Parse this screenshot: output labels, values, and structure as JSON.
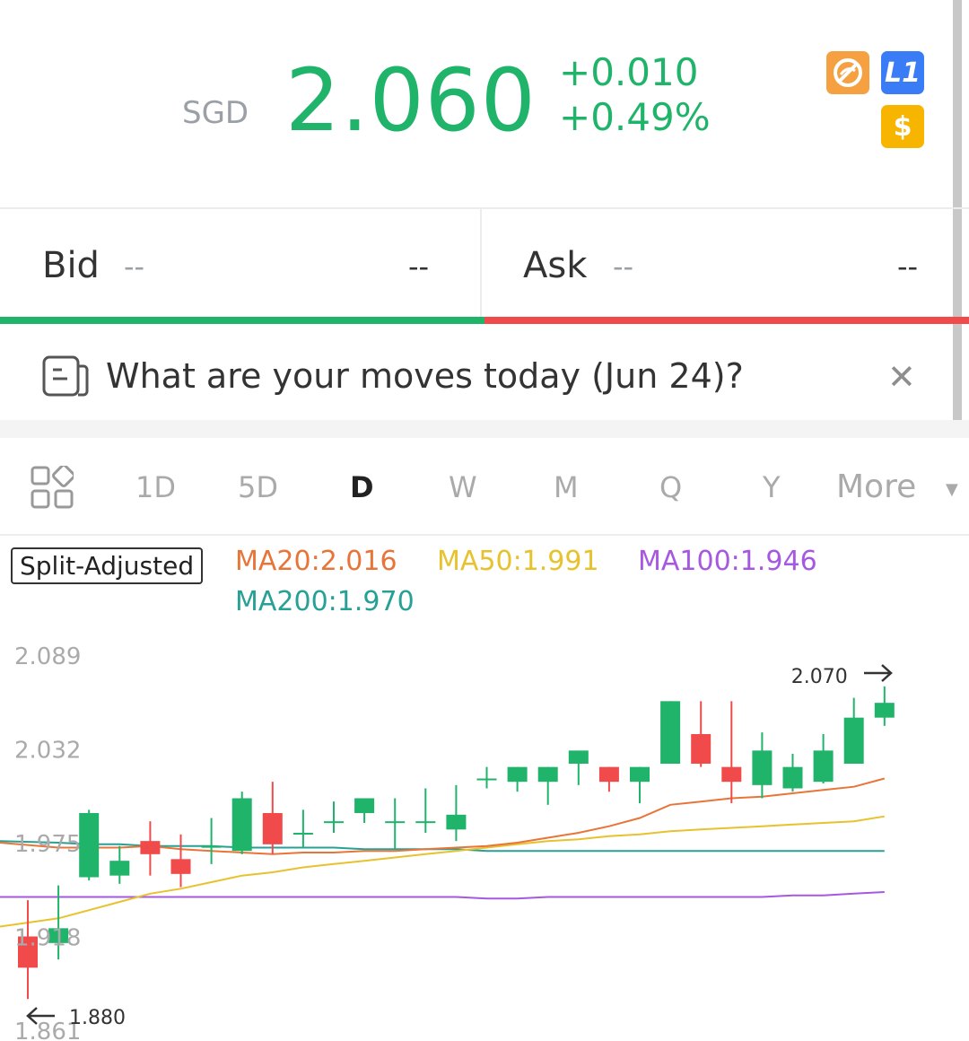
{
  "quote": {
    "currency": "SGD",
    "price": "2.060",
    "change": "+0.010",
    "change_pct": "+0.49%",
    "color": "#1fb46a"
  },
  "badges": [
    {
      "icon": "no-short-icon",
      "color": "#f5a142"
    },
    {
      "label": "L1",
      "icon": "level1-icon",
      "color": "#3a7bf6"
    },
    {
      "label": "$",
      "icon": "dollar-icon",
      "color": "#f7b500"
    }
  ],
  "orderbook": {
    "bid_label": "Bid",
    "bid_price": "--",
    "bid_size": "--",
    "ask_label": "Ask",
    "ask_price": "--",
    "ask_size": "--",
    "bid_color": "#1fb46a",
    "ask_color": "#f04a4a"
  },
  "banner": {
    "text": "What are your moves today (Jun 24)?",
    "icon": "note-icon",
    "close_icon": "close-icon"
  },
  "tabs": {
    "items": [
      "1D",
      "5D",
      "D",
      "W",
      "M",
      "Q",
      "Y"
    ],
    "active": "D",
    "more": "More",
    "grid_icon": "grid-icon"
  },
  "indicators": {
    "split_adjusted": "Split-Adjusted",
    "ma20": "MA20:2.016",
    "ma50": "MA50:1.991",
    "ma100": "MA100:1.946",
    "ma200": "MA200:1.970",
    "colors": {
      "ma20": "#e87537",
      "ma50": "#e8c22e",
      "ma100": "#a659e0",
      "ma200": "#27a096"
    }
  },
  "chart_data": {
    "type": "candlestick",
    "y_ticks": [
      "2.089",
      "2.032",
      "1.975",
      "1.918",
      "1.861"
    ],
    "ylim": [
      1.861,
      2.089
    ],
    "high_label": "2.070",
    "low_label": "1.880",
    "up_color": "#1fb46a",
    "down_color": "#f04a4a",
    "flat_color": "#1fb46a",
    "candles": [
      {
        "o": 1.918,
        "h": 1.94,
        "l": 1.88,
        "c": 1.899
      },
      {
        "o": 1.914,
        "h": 1.949,
        "l": 1.904,
        "c": 1.923
      },
      {
        "o": 1.954,
        "h": 1.995,
        "l": 1.952,
        "c": 1.993
      },
      {
        "o": 1.955,
        "h": 1.973,
        "l": 1.95,
        "c": 1.964
      },
      {
        "o": 1.976,
        "h": 1.988,
        "l": 1.955,
        "c": 1.968
      },
      {
        "o": 1.965,
        "h": 1.98,
        "l": 1.948,
        "c": 1.956
      },
      {
        "o": 1.973,
        "h": 1.99,
        "l": 1.962,
        "c": 1.973
      },
      {
        "o": 1.97,
        "h": 2.006,
        "l": 1.968,
        "c": 2.002
      },
      {
        "o": 1.993,
        "h": 2.012,
        "l": 1.968,
        "c": 1.974
      },
      {
        "o": 1.981,
        "h": 1.995,
        "l": 1.972,
        "c": 1.981
      },
      {
        "o": 1.988,
        "h": 2.0,
        "l": 1.981,
        "c": 1.988
      },
      {
        "o": 1.993,
        "h": 2.002,
        "l": 1.987,
        "c": 2.002
      },
      {
        "o": 1.988,
        "h": 2.002,
        "l": 1.971,
        "c": 1.988
      },
      {
        "o": 1.988,
        "h": 2.008,
        "l": 1.981,
        "c": 1.988
      },
      {
        "o": 1.983,
        "h": 2.01,
        "l": 1.976,
        "c": 1.992
      },
      {
        "o": 2.014,
        "h": 2.021,
        "l": 2.008,
        "c": 2.014
      },
      {
        "o": 2.012,
        "h": 2.021,
        "l": 2.006,
        "c": 2.021
      },
      {
        "o": 2.012,
        "h": 2.021,
        "l": 1.998,
        "c": 2.021
      },
      {
        "o": 2.023,
        "h": 2.029,
        "l": 2.01,
        "c": 2.031
      },
      {
        "o": 2.021,
        "h": 2.021,
        "l": 2.006,
        "c": 2.012
      },
      {
        "o": 2.012,
        "h": 2.021,
        "l": 1.999,
        "c": 2.021
      },
      {
        "o": 2.023,
        "h": 2.061,
        "l": 2.023,
        "c": 2.061
      },
      {
        "o": 2.041,
        "h": 2.061,
        "l": 2.021,
        "c": 2.023
      },
      {
        "o": 2.021,
        "h": 2.061,
        "l": 1.999,
        "c": 2.012
      },
      {
        "o": 2.01,
        "h": 2.042,
        "l": 2.002,
        "c": 2.031
      },
      {
        "o": 2.008,
        "h": 2.029,
        "l": 2.006,
        "c": 2.021
      },
      {
        "o": 2.012,
        "h": 2.041,
        "l": 2.011,
        "c": 2.031
      },
      {
        "o": 2.023,
        "h": 2.063,
        "l": 2.023,
        "c": 2.051
      },
      {
        "o": 2.051,
        "h": 2.07,
        "l": 2.046,
        "c": 2.06
      }
    ],
    "ma_lines": {
      "ma20": [
        1.975,
        1.972,
        1.972,
        1.972,
        1.973,
        1.971,
        1.97,
        1.969,
        1.968,
        1.969,
        1.969,
        1.97,
        1.97,
        1.971,
        1.972,
        1.973,
        1.975,
        1.978,
        1.981,
        1.985,
        1.99,
        1.998,
        2.0,
        2.002,
        2.003,
        2.005,
        2.007,
        2.009,
        2.014
      ],
      "ma50": [
        1.924,
        1.929,
        1.934,
        1.939,
        1.944,
        1.947,
        1.951,
        1.955,
        1.957,
        1.96,
        1.962,
        1.964,
        1.966,
        1.968,
        1.97,
        1.972,
        1.974,
        1.976,
        1.977,
        1.979,
        1.98,
        1.982,
        1.983,
        1.984,
        1.985,
        1.986,
        1.987,
        1.988,
        1.991
      ],
      "ma100": [
        1.942,
        1.942,
        1.942,
        1.942,
        1.942,
        1.942,
        1.942,
        1.942,
        1.942,
        1.942,
        1.942,
        1.942,
        1.942,
        1.942,
        1.942,
        1.941,
        1.941,
        1.942,
        1.942,
        1.942,
        1.942,
        1.942,
        1.942,
        1.942,
        1.942,
        1.943,
        1.943,
        1.944,
        1.945
      ],
      "ma200": [
        1.976,
        1.975,
        1.974,
        1.974,
        1.973,
        1.973,
        1.973,
        1.972,
        1.972,
        1.972,
        1.972,
        1.971,
        1.971,
        1.971,
        1.971,
        1.97,
        1.97,
        1.97,
        1.97,
        1.97,
        1.97,
        1.97,
        1.97,
        1.97,
        1.97,
        1.97,
        1.97,
        1.97,
        1.97
      ]
    }
  }
}
